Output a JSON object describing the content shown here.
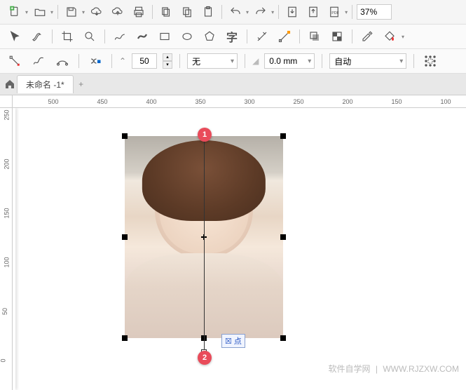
{
  "toolbar": {
    "zoom": "37%"
  },
  "toolbox": {
    "text_label": "字"
  },
  "props": {
    "angle_value": "50",
    "line_style": "无",
    "offset": "0.0 mm",
    "preset": "自动"
  },
  "tabs": {
    "doc_name": "未命名 -1*"
  },
  "ruler_h": [
    "500",
    "450",
    "400",
    "350",
    "300",
    "250",
    "200",
    "150",
    "100"
  ],
  "ruler_v": [
    "250",
    "200",
    "150",
    "100",
    "50",
    "0"
  ],
  "annotations": {
    "badge1": "1",
    "badge2": "2",
    "node_tooltip": "☒ 点"
  },
  "watermark": {
    "site_cn": "软件自学网",
    "site_url": "WWW.RJZXW.COM"
  }
}
